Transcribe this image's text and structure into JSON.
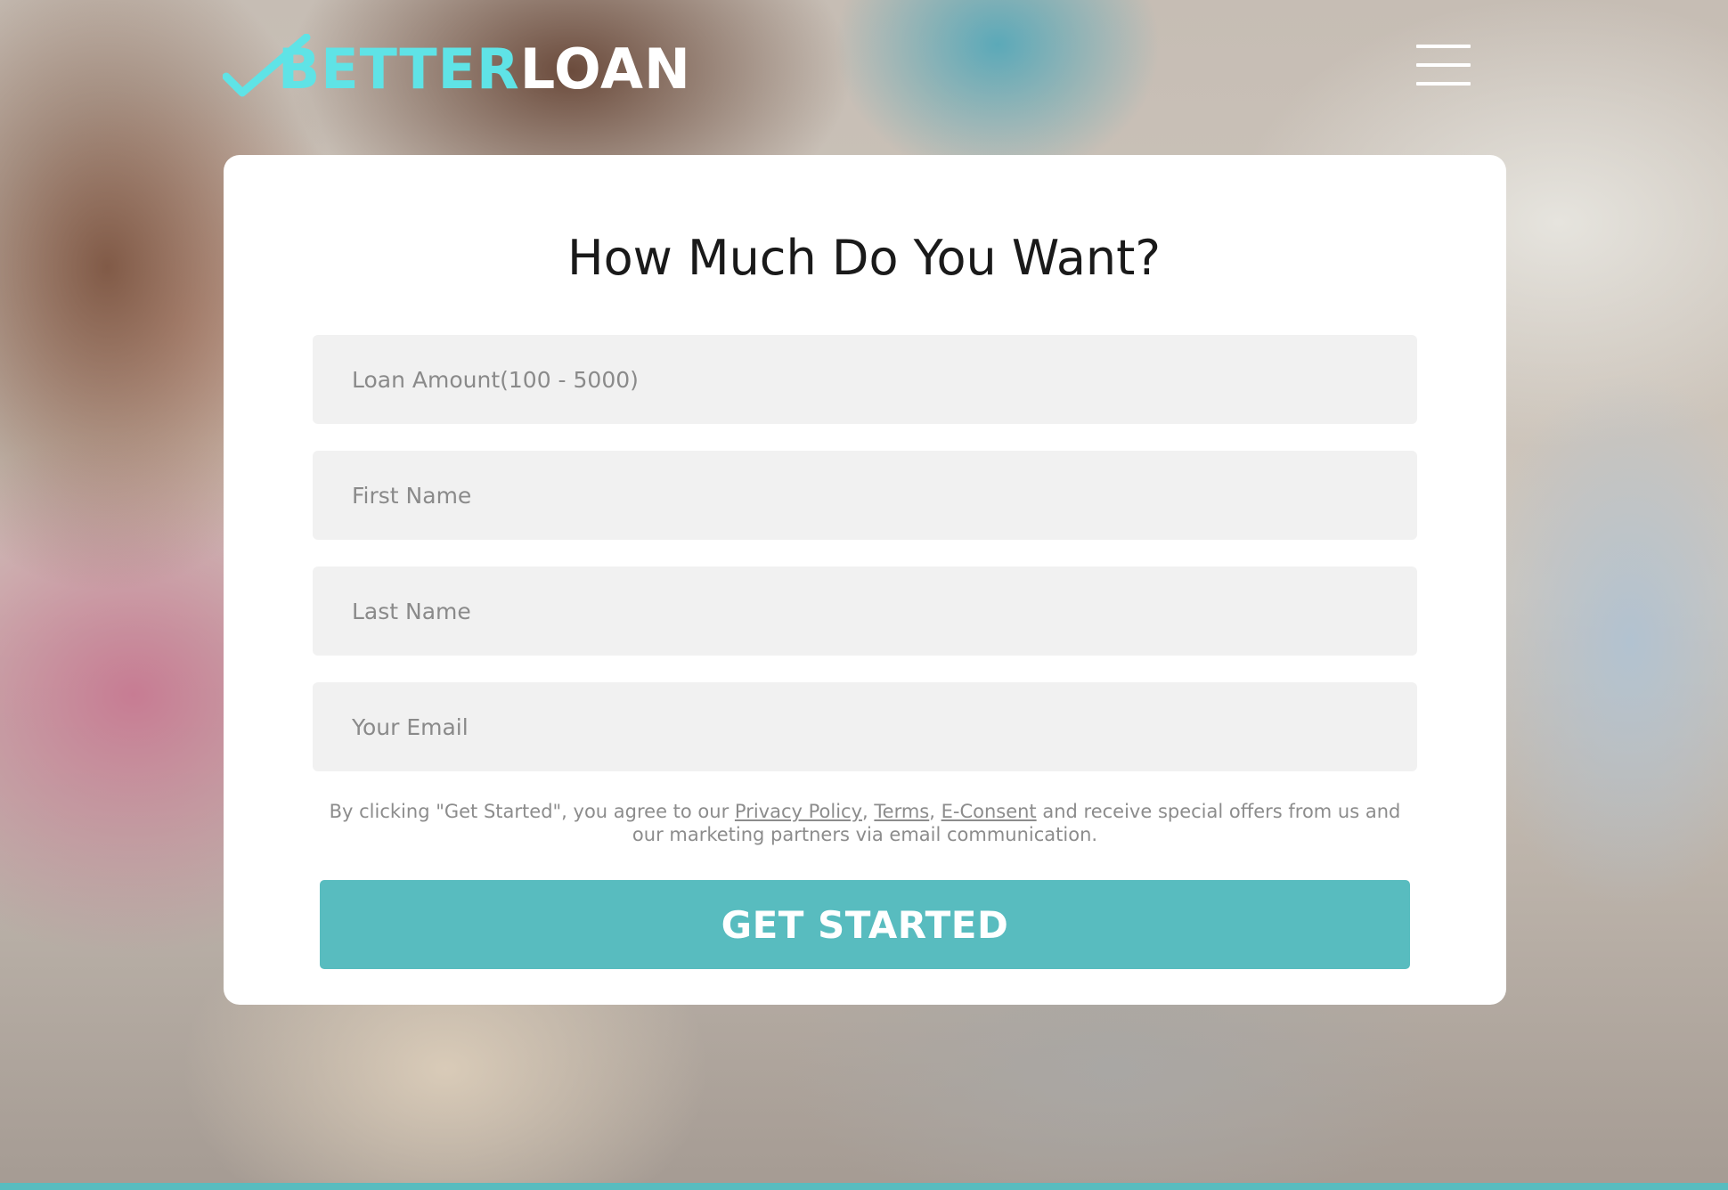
{
  "brand": {
    "name_part1": "BETTER",
    "name_part2": "LOAN",
    "accent_color": "#5fe3e6",
    "checkmark_icon": "checkmark-icon"
  },
  "header": {
    "menu_icon": "hamburger-menu-icon"
  },
  "form": {
    "title": "How Much Do You Want?",
    "fields": {
      "loan_amount_placeholder": "Loan Amount(100 - 5000)",
      "first_name_placeholder": "First Name",
      "last_name_placeholder": "Last Name",
      "email_placeholder": "Your Email"
    },
    "consent": {
      "prefix": "By clicking \"Get Started\", you agree to our ",
      "privacy_link": "Privacy Policy",
      "sep1": ", ",
      "terms_link": "Terms",
      "sep2": ", ",
      "econsent_link": "E-Consent",
      "suffix": " and receive special offers from us and our marketing partners via email communication."
    },
    "submit_label": "GET STARTED",
    "button_color": "#58bcbf"
  }
}
